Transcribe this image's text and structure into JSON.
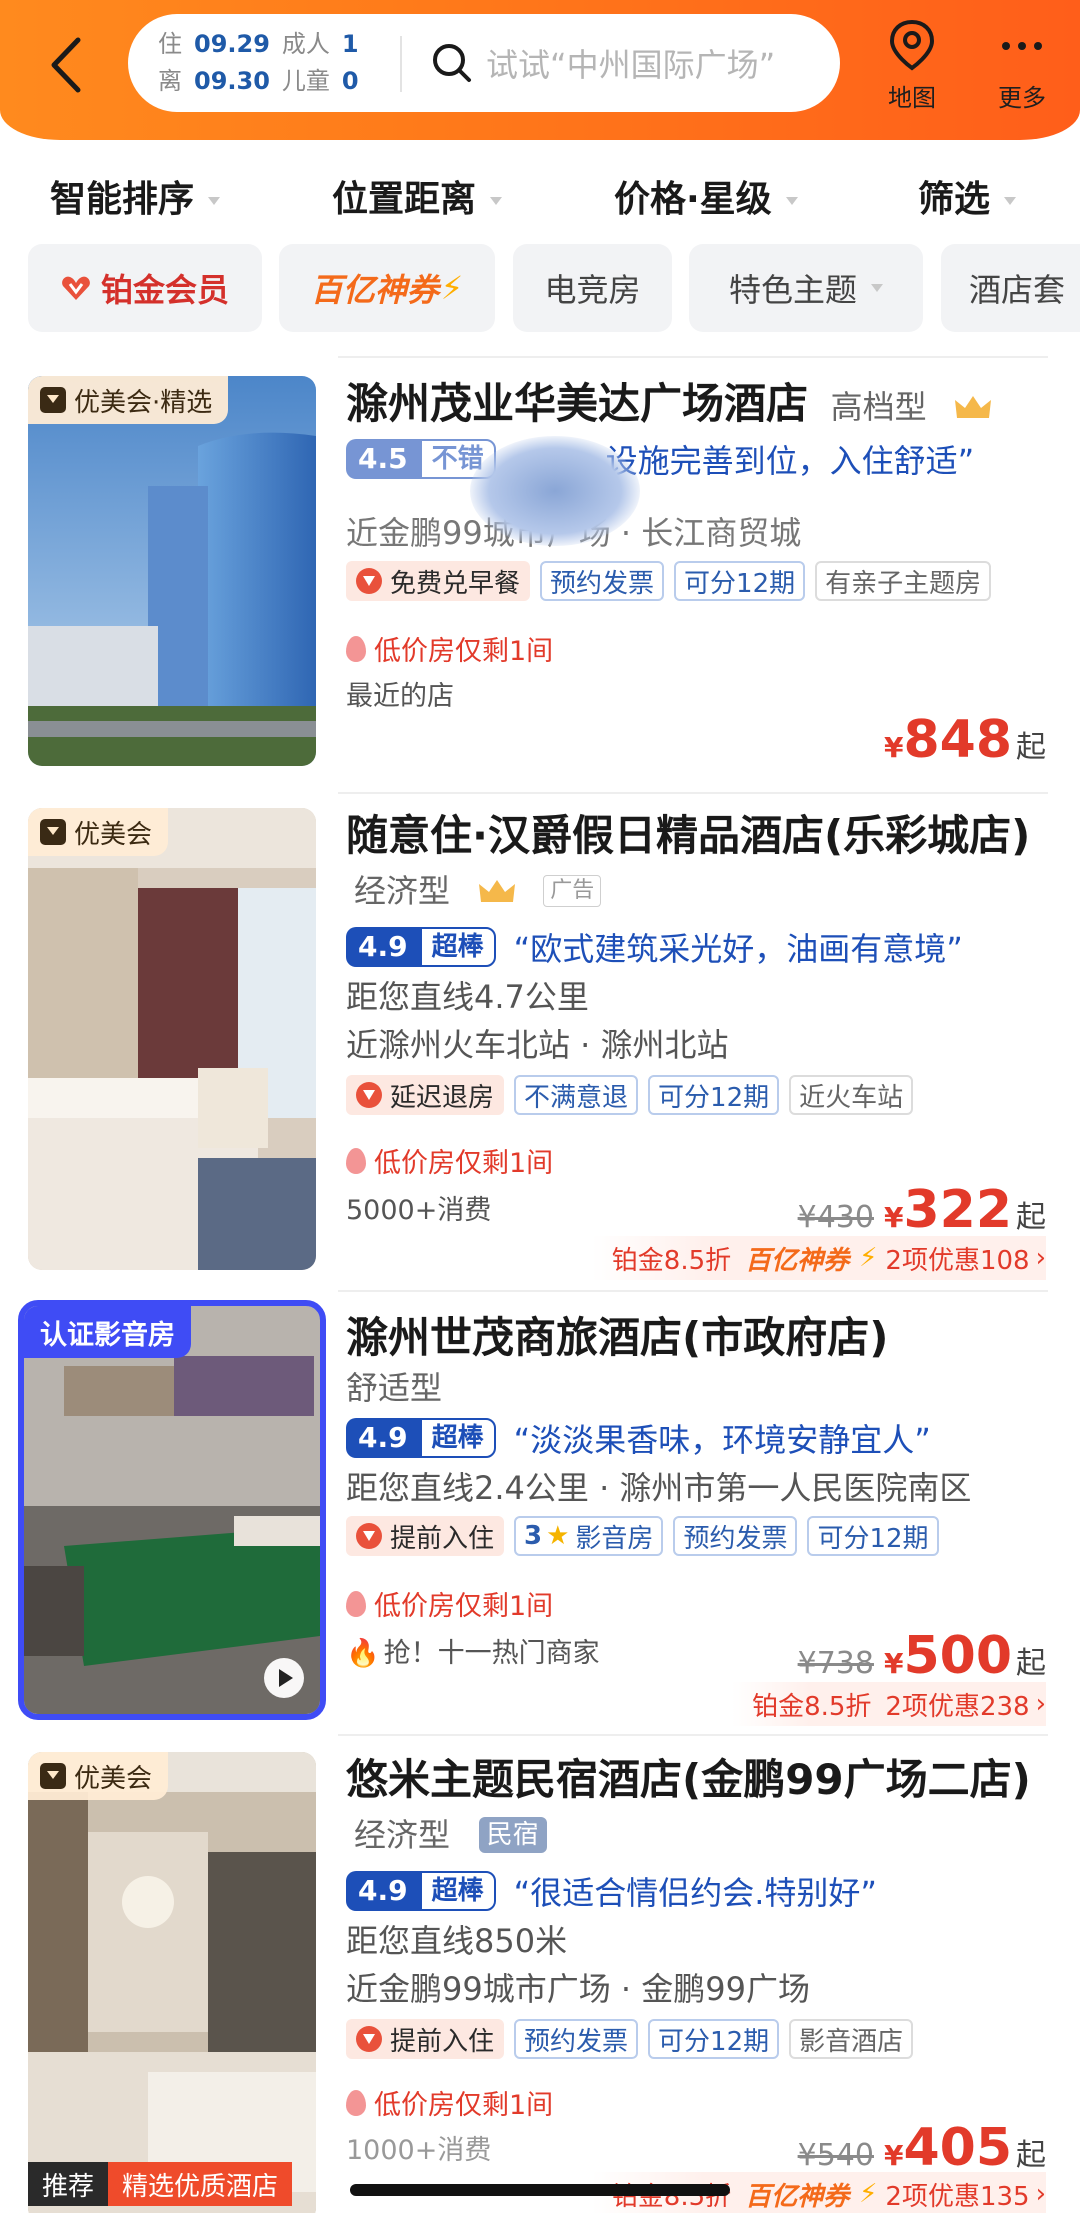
{
  "header": {
    "checkin_label": "住",
    "checkin_date": "09.29",
    "checkout_label": "离",
    "checkout_date": "09.30",
    "adult_label": "成人",
    "adult_count": "1",
    "child_label": "儿童",
    "child_count": "0",
    "search_placeholder": "试试“中州国际广场”",
    "map_label": "地图",
    "more_label": "更多"
  },
  "sort_bar": [
    "智能排序",
    "位置距离",
    "价格·星级",
    "筛选"
  ],
  "chips": {
    "platinum": "铂金会员",
    "coupon": "百亿神券",
    "esports": "电竞房",
    "theme": "特色主题",
    "hotel_partial": "酒店套"
  },
  "hotels": [
    {
      "badge": "优美会·精选",
      "name": "滁州茂业华美达广场酒店",
      "type": "高档型",
      "score": "4.5",
      "score_label": "不错",
      "review": "设施完善到位，入住舒适”",
      "location": "近金鹏99城市广场 · 长江商贸城",
      "tag_highlight": "免费兑早餐",
      "tags": [
        "预约发票",
        "可分12期"
      ],
      "tag_gray": "有亲子主题房",
      "low_stock": "低价房仅剩1间",
      "note": "最近的店",
      "yen": "¥",
      "price": "848",
      "qi": "起"
    },
    {
      "badge": "优美会",
      "name": "随意住·汉爵假日精品酒店(乐彩城店)",
      "type": "经济型",
      "ad": "广告",
      "score": "4.9",
      "score_label": "超棒",
      "review": "“欧式建筑采光好，油画有意境”",
      "distance": "距您直线4.7公里",
      "location": "近滁州火车北站 · 滁州北站",
      "tag_highlight": "延迟退房",
      "tags": [
        "不满意退",
        "可分12期"
      ],
      "tag_gray": "近火车站",
      "low_stock": "低价房仅剩1间",
      "original_price": "¥430",
      "yen": "¥",
      "price": "322",
      "qi": "起",
      "consume": "5000+消费",
      "promo_platinum": "铂金8.5折",
      "promo_coupon": "百亿神券",
      "promo_discount": "2项优惠108"
    },
    {
      "badge": "认证影音房",
      "name": "滁州世茂商旅酒店(市政府店)",
      "type": "舒适型",
      "score": "4.9",
      "score_label": "超棒",
      "review": "“淡淡果香味，环境安静宜人”",
      "distance": "距您直线2.4公里 · 滁州市第一人民医院南区",
      "tag_highlight": "提前入住",
      "av_stars": "3",
      "av_label": "影音房",
      "tags": [
        "预约发票",
        "可分12期"
      ],
      "low_stock": "低价房仅剩1间",
      "original_price": "¥738",
      "yen": "¥",
      "price": "500",
      "qi": "起",
      "hot": "抢！十一热门商家",
      "promo_platinum": "铂金8.5折",
      "promo_discount": "2项优惠238"
    },
    {
      "badge": "优美会",
      "name": "悠米主题民宿酒店(金鹏99广场二店)",
      "type": "经济型",
      "bnb": "民宿",
      "score": "4.9",
      "score_label": "超棒",
      "review": "“很适合情侣约会.特别好”",
      "distance": "距您直线850米",
      "location": "近金鹏99城市广场 · 金鹏99广场",
      "tag_highlight": "提前入住",
      "tags": [
        "预约发票",
        "可分12期"
      ],
      "tag_gray": "影音酒店",
      "low_stock": "低价房仅剩1间",
      "original_price": "¥540",
      "yen": "¥",
      "price": "405",
      "qi": "起",
      "consume": "1000+消费",
      "promo_platinum": "铂金8.5折",
      "promo_coupon": "百亿神券",
      "promo_discount": "2项优惠135",
      "photo_tag_1": "推荐",
      "photo_tag_2": "精选优质酒店"
    }
  ],
  "colors": {
    "header_orange": "#ff7a1a",
    "price_red": "#e23a2a",
    "rating_blue": "#1d4fb8",
    "frame_blue": "#3f4cf5"
  }
}
